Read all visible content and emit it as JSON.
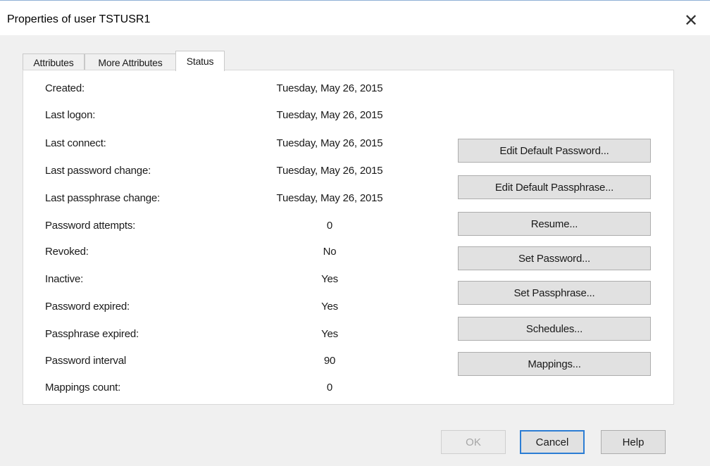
{
  "window": {
    "title": "Properties of user TSTUSR1",
    "close_glyph": "✕"
  },
  "tabs": [
    {
      "label": "Attributes",
      "active": false
    },
    {
      "label": "More Attributes",
      "active": false
    },
    {
      "label": "Status",
      "active": true
    }
  ],
  "status_rows": [
    {
      "label": "Created:",
      "value": "Tuesday, May 26, 2015"
    },
    {
      "label": "Last logon:",
      "value": "Tuesday, May 26, 2015"
    },
    {
      "label": "Last connect:",
      "value": "Tuesday, May 26, 2015"
    },
    {
      "label": "Last password change:",
      "value": "Tuesday, May 26, 2015"
    },
    {
      "label": "Last passphrase change:",
      "value": "Tuesday, May 26, 2015"
    },
    {
      "label": "Password attempts:",
      "value": "0"
    },
    {
      "label": "Revoked:",
      "value": "No"
    },
    {
      "label": "Inactive:",
      "value": "Yes"
    },
    {
      "label": "Password expired:",
      "value": "Yes"
    },
    {
      "label": "Passphrase expired:",
      "value": "Yes"
    },
    {
      "label": "Password interval",
      "value": "90"
    },
    {
      "label": "Mappings count:",
      "value": "0"
    }
  ],
  "actions": [
    "Edit Default Password...",
    "Edit Default Passphrase...",
    "Resume...",
    "Set Password...",
    "Set Passphrase...",
    "Schedules...",
    "Mappings..."
  ],
  "buttons": {
    "ok": "OK",
    "cancel": "Cancel",
    "help": "Help"
  },
  "colors": {
    "dialog_bg": "#f0f0f0",
    "panel_bg": "#ffffff",
    "default_button_border": "#2c7dd4"
  }
}
